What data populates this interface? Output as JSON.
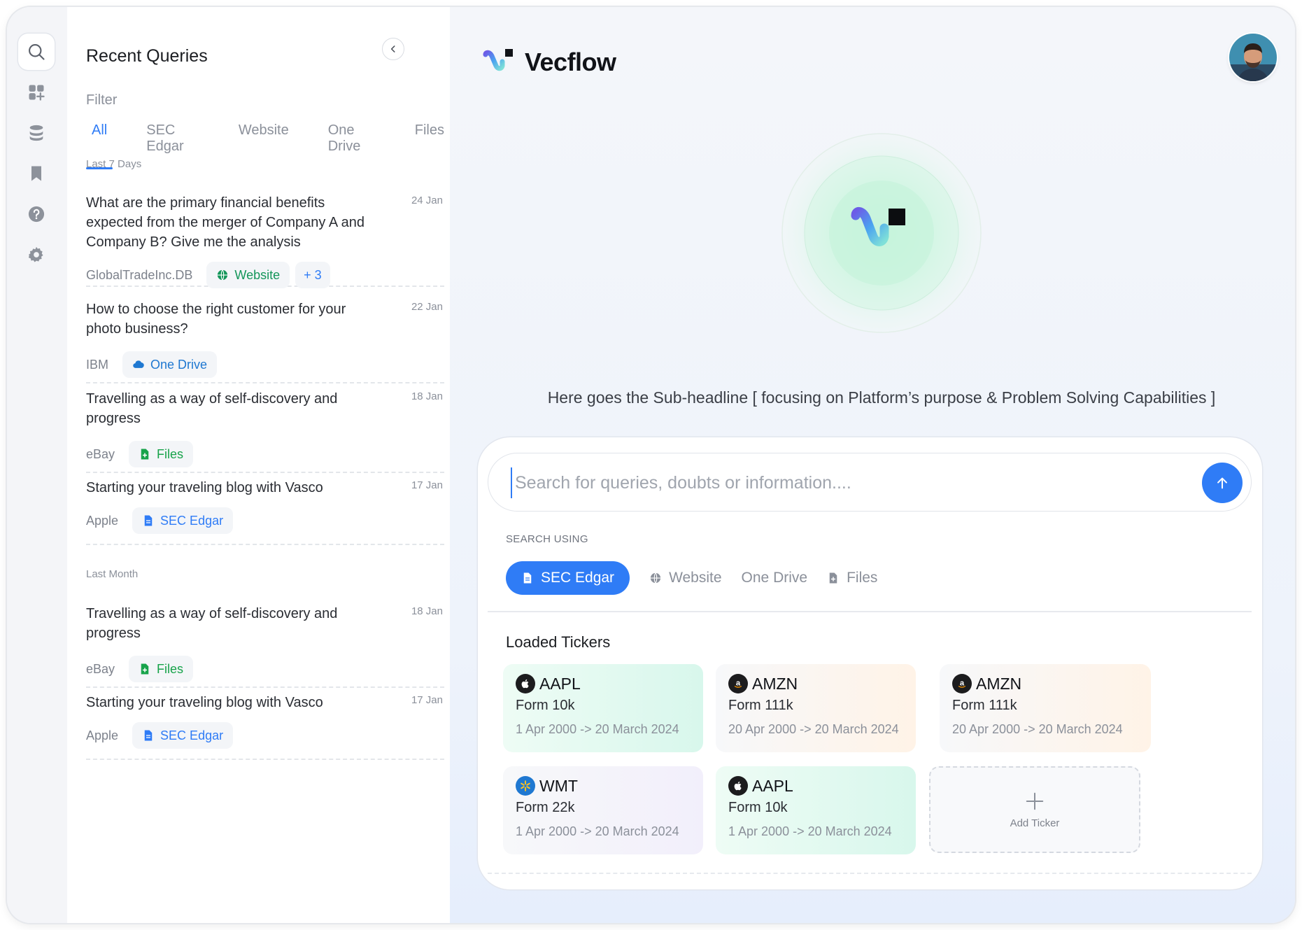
{
  "app": {
    "name": "Vecflow"
  },
  "sidebar": {
    "title": "Recent Queries",
    "filter_label": "Filter",
    "filter_tabs": [
      "All",
      "SEC Edgar",
      "Website",
      "One Drive",
      "Files"
    ],
    "groups": [
      {
        "label": "Last 7 Days"
      },
      {
        "label": "Last Month"
      }
    ],
    "queries": [
      {
        "text": "What are the primary financial benefits expected from the merger of Company A and Company B? Give me the analysis",
        "date": "24 Jan",
        "source": "GlobalTradeInc.DB",
        "chip": "Website",
        "more": "+ 3"
      },
      {
        "text": "How to choose the right customer for your photo business?",
        "date": "22 Jan",
        "source": "IBM",
        "chip": "One Drive"
      },
      {
        "text": "Travelling as a way of self-discovery and progress",
        "date": "18 Jan",
        "source": "eBay",
        "chip": "Files"
      },
      {
        "text": "Starting your traveling blog with Vasco",
        "date": "17 Jan",
        "source": "Apple",
        "chip": "SEC Edgar"
      },
      {
        "text": "Travelling as a way of self-discovery and progress",
        "date": "18 Jan",
        "source": "eBay",
        "chip": "Files"
      },
      {
        "text": "Starting your traveling blog with Vasco",
        "date": "17 Jan",
        "source": "Apple",
        "chip": "SEC Edgar"
      }
    ]
  },
  "main": {
    "subheadline": "Here goes the Sub-headline [ focusing on Platform’s purpose & Problem Solving Capabilities ]",
    "search": {
      "placeholder": "Search for queries, doubts or information....",
      "using_label": "SEARCH USING",
      "sources": [
        "SEC Edgar",
        "Website",
        "One Drive",
        "Files"
      ]
    },
    "tickers_title": "Loaded Tickers",
    "tickers": [
      {
        "symbol": "AAPL",
        "form": "Form 10k",
        "range": "1 Apr 2000 -> 20 March 2024",
        "logo": "apple-icon"
      },
      {
        "symbol": "AMZN",
        "form": "Form 111k",
        "range": "20 Apr 2000 -> 20 March 2024",
        "logo": "amazon-icon"
      },
      {
        "symbol": "AMZN",
        "form": "Form 111k",
        "range": "20 Apr 2000 -> 20 March 2024",
        "logo": "amazon-icon"
      },
      {
        "symbol": "WMT",
        "form": "Form 22k",
        "range": "1 Apr 2000 -> 20 March 2024",
        "logo": "walmart-icon"
      },
      {
        "symbol": "AAPL",
        "form": "Form 10k",
        "range": "1 Apr 2000 -> 20 March 2024",
        "logo": "apple-icon"
      }
    ],
    "add_ticker_label": "Add Ticker"
  },
  "colors": {
    "accent": "#2f7cf6",
    "website": "#14965a",
    "onedrive": "#1f78d1",
    "files": "#17a34a"
  }
}
